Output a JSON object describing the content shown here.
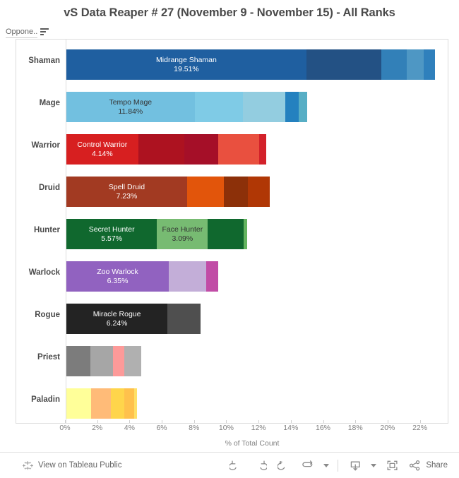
{
  "title": "vS Data Reaper # 27 (November 9 - November 15) - All Ranks",
  "field_header": {
    "label": "Oppone..",
    "sort_icon": "sort-descending-icon"
  },
  "axis": {
    "title": "% of Total Count",
    "ticks": [
      "0%",
      "2%",
      "4%",
      "6%",
      "8%",
      "10%",
      "12%",
      "14%",
      "16%",
      "18%",
      "20%",
      "22%"
    ],
    "tick_values": [
      0,
      2,
      4,
      6,
      8,
      10,
      12,
      14,
      16,
      18,
      20,
      22
    ],
    "min": 0,
    "max": 23.2
  },
  "toolbar": {
    "view_label": "View on Tableau Public",
    "tableau_icon": "tableau-logo-icon",
    "undo_icon": "undo-icon",
    "redo_icon": "redo-icon",
    "revert_icon": "revert-icon",
    "refresh_icon": "refresh-icon",
    "refresh_caret_icon": "chevron-down-icon",
    "download_icon": "download-icon",
    "download_caret_icon": "chevron-down-icon",
    "fullscreen_icon": "fullscreen-icon",
    "share_icon": "share-icon",
    "share_label": "Share"
  },
  "chart_data": {
    "type": "bar",
    "orientation": "horizontal",
    "stacked": true,
    "title": "vS Data Reaper # 27 (November 9 - November 15) - All Ranks",
    "xlabel": "% of Total Count",
    "ylabel": "",
    "xlim": [
      0,
      23.2
    ],
    "grid": false,
    "legend": "none",
    "categories": [
      "Shaman",
      "Mage",
      "Warrior",
      "Druid",
      "Hunter",
      "Warlock",
      "Rogue",
      "Priest",
      "Paladin"
    ],
    "totals": [
      22.85,
      15.23,
      12.4,
      12.6,
      11.2,
      9.4,
      8.3,
      4.65,
      4.4
    ],
    "rows": [
      {
        "class": "Shaman",
        "total": 22.85,
        "segments": [
          {
            "label": "Midrange Shaman",
            "value": 19.51,
            "width": 14.88,
            "color": "#1f5fa0",
            "text_color": "#ffffff",
            "show_label": true
          },
          {
            "label": "",
            "value": 0.0,
            "width": 4.63,
            "color": "#235184",
            "text_color": "#ffffff",
            "show_label": false
          },
          {
            "label": "",
            "value": 0.0,
            "width": 1.6,
            "color": "#3280b8",
            "text_color": "#ffffff",
            "show_label": false
          },
          {
            "label": "",
            "value": 0.0,
            "width": 1.05,
            "color": "#4e97c4",
            "text_color": "#ffffff",
            "show_label": false
          },
          {
            "label": "",
            "value": 0.0,
            "width": 0.69,
            "color": "#2f80bc",
            "text_color": "#ffffff",
            "show_label": false
          }
        ]
      },
      {
        "class": "Mage",
        "total": 15.23,
        "segments": [
          {
            "label": "Tempo Mage",
            "value": 11.84,
            "width": 7.95,
            "color": "#72c0e0",
            "text_color": "#333333",
            "show_label": true
          },
          {
            "label": "",
            "value": 0.0,
            "width": 3.0,
            "color": "#7fcbe6",
            "text_color": "#333333",
            "show_label": false
          },
          {
            "label": "",
            "value": 0.0,
            "width": 2.64,
            "color": "#93cde0",
            "text_color": "#333333",
            "show_label": false
          },
          {
            "label": "",
            "value": 0.0,
            "width": 0.82,
            "color": "#2481bf",
            "text_color": "#ffffff",
            "show_label": false
          },
          {
            "label": "",
            "value": 0.0,
            "width": 0.5,
            "color": "#57aec5",
            "text_color": "#ffffff",
            "show_label": false
          }
        ]
      },
      {
        "class": "Warrior",
        "total": 12.4,
        "segments": [
          {
            "label": "Control Warrior",
            "value": 4.14,
            "width": 4.45,
            "color": "#d71f20",
            "text_color": "#ffffff",
            "show_label": true
          },
          {
            "label": "",
            "value": 0.0,
            "width": 2.85,
            "color": "#ad1220",
            "text_color": "#ffffff",
            "show_label": false
          },
          {
            "label": "",
            "value": 0.0,
            "width": 2.1,
            "color": "#a50f28",
            "text_color": "#ffffff",
            "show_label": false
          },
          {
            "label": "",
            "value": 0.0,
            "width": 2.55,
            "color": "#e9503f",
            "text_color": "#ffffff",
            "show_label": false
          },
          {
            "label": "",
            "value": 0.0,
            "width": 0.45,
            "color": "#d3212a",
            "text_color": "#ffffff",
            "show_label": false
          }
        ]
      },
      {
        "class": "Druid",
        "total": 12.6,
        "segments": [
          {
            "label": "Spell Druid",
            "value": 7.23,
            "width": 7.48,
            "color": "#a23a22",
            "text_color": "#ffffff",
            "show_label": true
          },
          {
            "label": "",
            "value": 0.0,
            "width": 2.3,
            "color": "#e2550b",
            "text_color": "#ffffff",
            "show_label": false
          },
          {
            "label": "",
            "value": 0.0,
            "width": 1.45,
            "color": "#8c3009",
            "text_color": "#ffffff",
            "show_label": false
          },
          {
            "label": "",
            "value": 0.0,
            "width": 1.37,
            "color": "#b03705",
            "text_color": "#ffffff",
            "show_label": false
          }
        ]
      },
      {
        "class": "Hunter",
        "total": 11.2,
        "segments": [
          {
            "label": "Secret Hunter",
            "value": 5.57,
            "width": 5.62,
            "color": "#10682e",
            "text_color": "#ffffff",
            "show_label": true
          },
          {
            "label": "Face Hunter",
            "value": 3.09,
            "width": 3.15,
            "color": "#77bb72",
            "text_color": "#333333",
            "show_label": true
          },
          {
            "label": "",
            "value": 0.0,
            "width": 2.2,
            "color": "#10682e",
            "text_color": "#ffffff",
            "show_label": false
          },
          {
            "label": "",
            "value": 0.0,
            "width": 0.23,
            "color": "#63b45f",
            "text_color": "#ffffff",
            "show_label": false
          }
        ]
      },
      {
        "class": "Warlock",
        "total": 9.4,
        "segments": [
          {
            "label": "Zoo Warlock",
            "value": 6.35,
            "width": 6.35,
            "color": "#9162c0",
            "text_color": "#ffffff",
            "show_label": true
          },
          {
            "label": "",
            "value": 0.0,
            "width": 2.3,
            "color": "#c3aed8",
            "text_color": "#333333",
            "show_label": false
          },
          {
            "label": "",
            "value": 0.0,
            "width": 0.75,
            "color": "#c14ca6",
            "text_color": "#ffffff",
            "show_label": false
          }
        ]
      },
      {
        "class": "Rogue",
        "total": 8.3,
        "segments": [
          {
            "label": "Miracle Rogue",
            "value": 6.24,
            "width": 6.27,
            "color": "#232323",
            "text_color": "#ffffff",
            "show_label": true
          },
          {
            "label": "",
            "value": 0.0,
            "width": 2.03,
            "color": "#4f4f4f",
            "text_color": "#ffffff",
            "show_label": false
          }
        ]
      },
      {
        "class": "Priest",
        "total": 4.65,
        "segments": [
          {
            "label": "",
            "value": 0.0,
            "width": 1.5,
            "color": "#7c7c7c",
            "text_color": "#ffffff",
            "show_label": false
          },
          {
            "label": "",
            "value": 0.0,
            "width": 1.38,
            "color": "#a6a6a6",
            "text_color": "#ffffff",
            "show_label": false
          },
          {
            "label": "",
            "value": 0.0,
            "width": 0.72,
            "color": "#fd9a99",
            "text_color": "#ffffff",
            "show_label": false
          },
          {
            "label": "",
            "value": 0.0,
            "width": 1.05,
            "color": "#b0b0b0",
            "text_color": "#ffffff",
            "show_label": false
          }
        ]
      },
      {
        "class": "Paladin",
        "total": 4.4,
        "segments": [
          {
            "label": "",
            "value": 0.0,
            "width": 1.55,
            "color": "#ffff99",
            "text_color": "#333333",
            "show_label": false
          },
          {
            "label": "",
            "value": 0.0,
            "width": 1.2,
            "color": "#ffbb78",
            "text_color": "#333333",
            "show_label": false
          },
          {
            "label": "",
            "value": 0.0,
            "width": 0.85,
            "color": "#ffd54b",
            "text_color": "#333333",
            "show_label": false
          },
          {
            "label": "",
            "value": 0.0,
            "width": 0.62,
            "color": "#ffc14c",
            "text_color": "#333333",
            "show_label": false
          },
          {
            "label": "",
            "value": 0.0,
            "width": 0.18,
            "color": "#ffe066",
            "text_color": "#333333",
            "show_label": false
          }
        ]
      }
    ]
  }
}
